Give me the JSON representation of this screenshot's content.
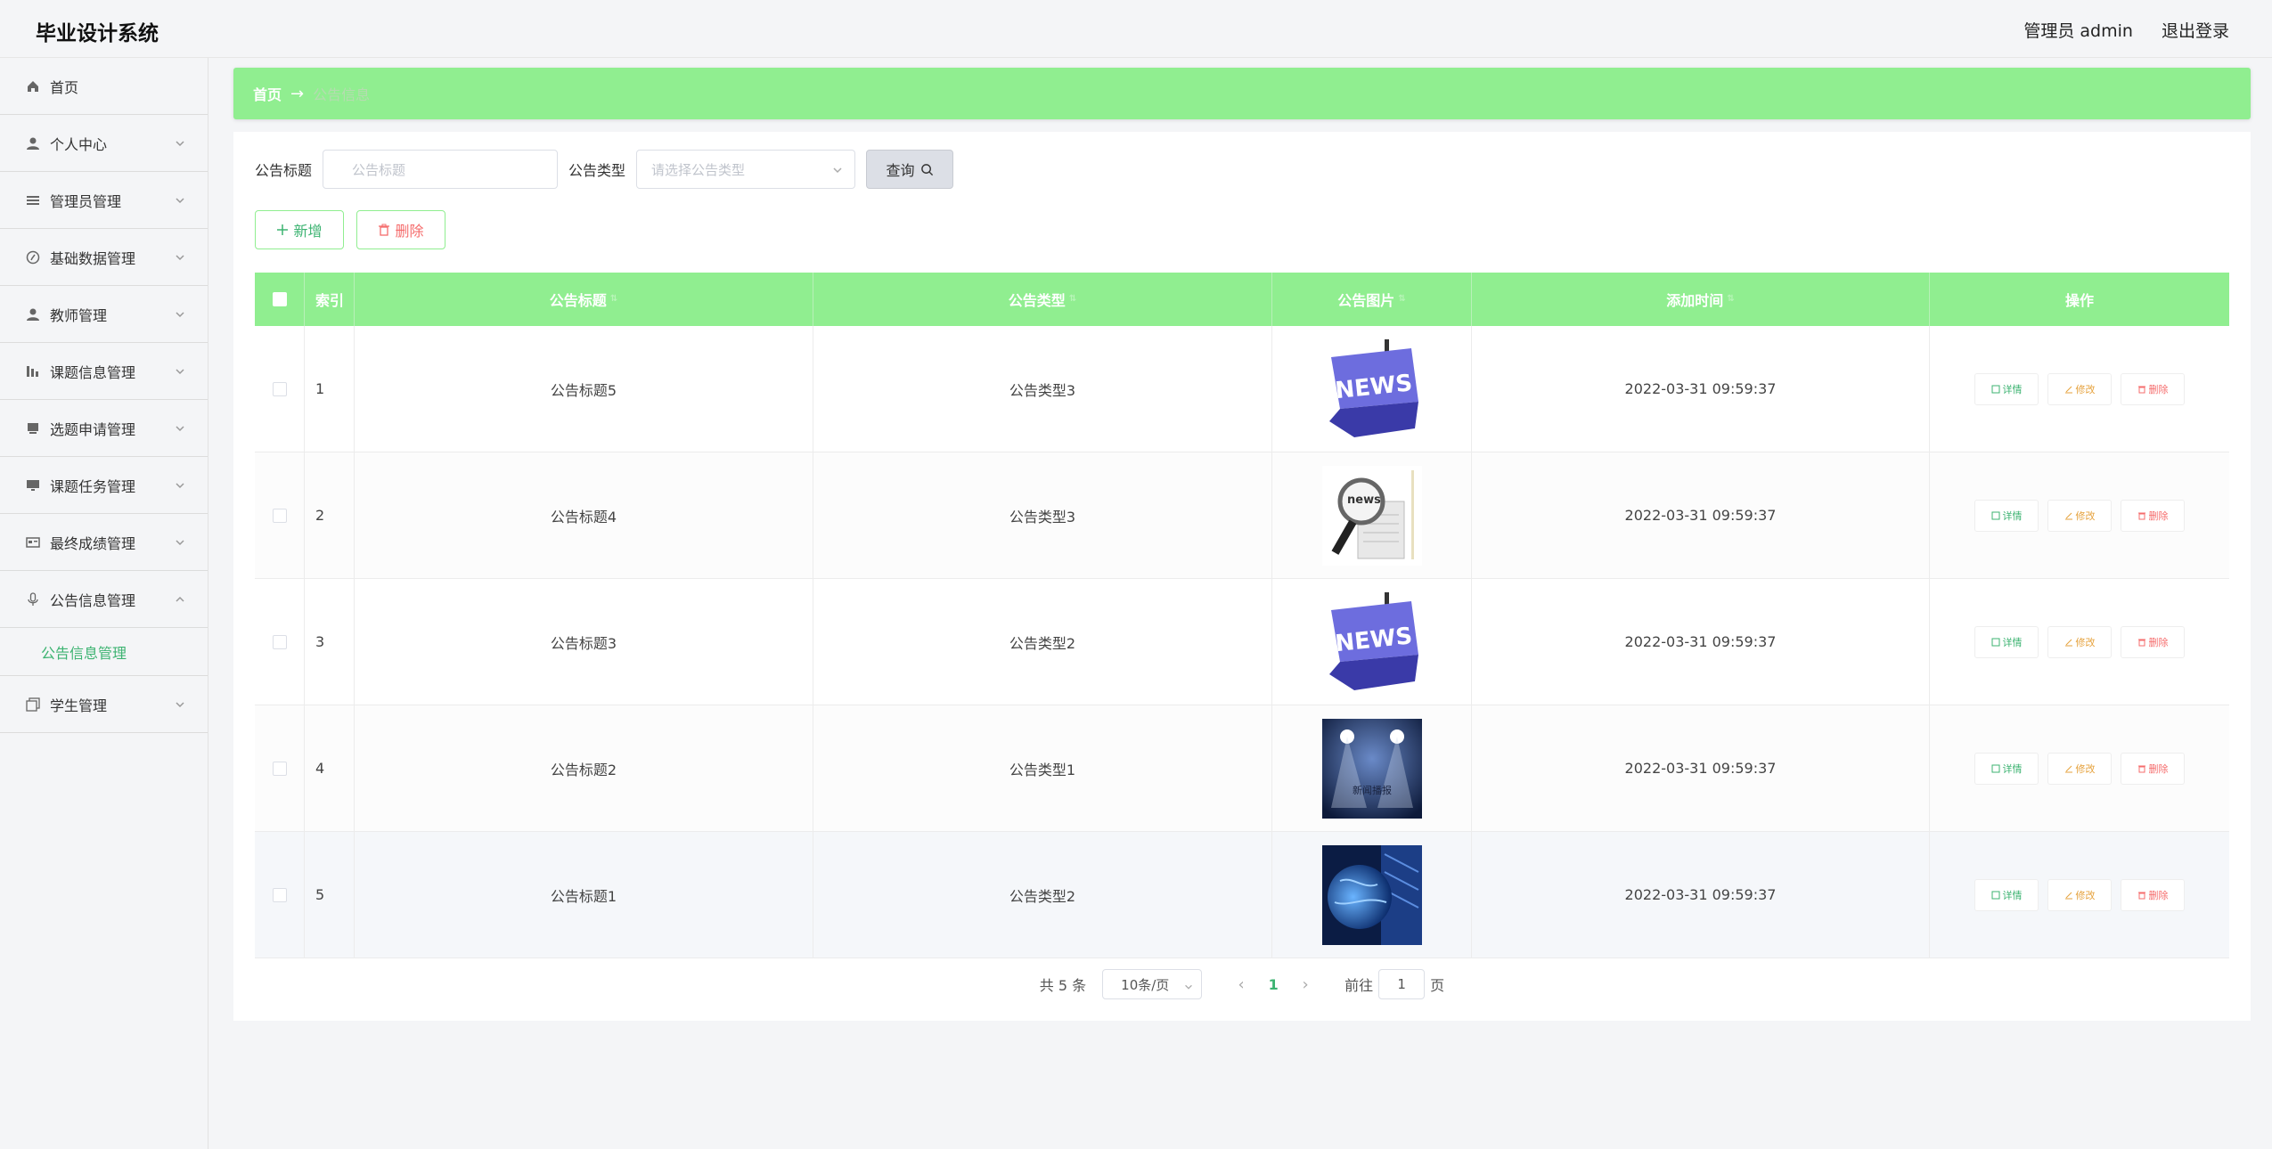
{
  "header": {
    "app_title": "毕业设计系统",
    "role": "管理员",
    "username": "admin",
    "logout": "退出登录"
  },
  "sidebar": {
    "items": [
      {
        "label": "首页",
        "icon": "home-icon"
      },
      {
        "label": "个人中心",
        "icon": "user-icon"
      },
      {
        "label": "管理员管理",
        "icon": "list-icon"
      },
      {
        "label": "基础数据管理",
        "icon": "compass-icon"
      },
      {
        "label": "教师管理",
        "icon": "user-icon"
      },
      {
        "label": "课题信息管理",
        "icon": "chart-icon"
      },
      {
        "label": "选题申请管理",
        "icon": "box-icon"
      },
      {
        "label": "课题任务管理",
        "icon": "monitor-icon"
      },
      {
        "label": "最终成绩管理",
        "icon": "card-icon"
      },
      {
        "label": "公告信息管理",
        "icon": "microphone-icon"
      },
      {
        "label": "学生管理",
        "icon": "copy-icon"
      }
    ],
    "submenu_active": "公告信息管理"
  },
  "breadcrumb": {
    "home": "首页",
    "arrow": "→",
    "current": "公告信息"
  },
  "search": {
    "title_label": "公告标题",
    "title_placeholder": "公告标题",
    "type_label": "公告类型",
    "type_placeholder": "请选择公告类型",
    "query_button": "查询"
  },
  "actions": {
    "add": "新增",
    "delete": "删除"
  },
  "table": {
    "headers": {
      "index": "索引",
      "title": "公告标题",
      "type": "公告类型",
      "image": "公告图片",
      "time": "添加时间",
      "ops": "操作"
    },
    "rows": [
      {
        "index": "1",
        "title": "公告标题5",
        "type": "公告类型3",
        "time": "2022-03-31 09:59:37",
        "image": "news-key-image"
      },
      {
        "index": "2",
        "title": "公告标题4",
        "type": "公告类型3",
        "time": "2022-03-31 09:59:37",
        "image": "magnifier-news-image"
      },
      {
        "index": "3",
        "title": "公告标题3",
        "type": "公告类型2",
        "time": "2022-03-31 09:59:37",
        "image": "news-key-image"
      },
      {
        "index": "4",
        "title": "公告标题2",
        "type": "公告类型1",
        "time": "2022-03-31 09:59:37",
        "image": "stage-lights-image"
      },
      {
        "index": "5",
        "title": "公告标题1",
        "type": "公告类型2",
        "time": "2022-03-31 09:59:37",
        "image": "globe-news-image"
      }
    ],
    "op_labels": {
      "view": "详情",
      "edit": "修改",
      "delete": "删除"
    }
  },
  "thumb_text": {
    "news": "NEWS",
    "small_news": "news",
    "stage": "新闻播报"
  },
  "pager": {
    "total": "共 5 条",
    "page_size": "10条/页",
    "prev": "‹",
    "next": "›",
    "current_page": "1",
    "goto_label": "前往",
    "goto_value": "1",
    "page_unit": "页"
  },
  "colors": {
    "accent": "#90ee90",
    "accent_text": "#3cb371",
    "danger": "#f56c6c",
    "warning": "#e6a23c"
  }
}
